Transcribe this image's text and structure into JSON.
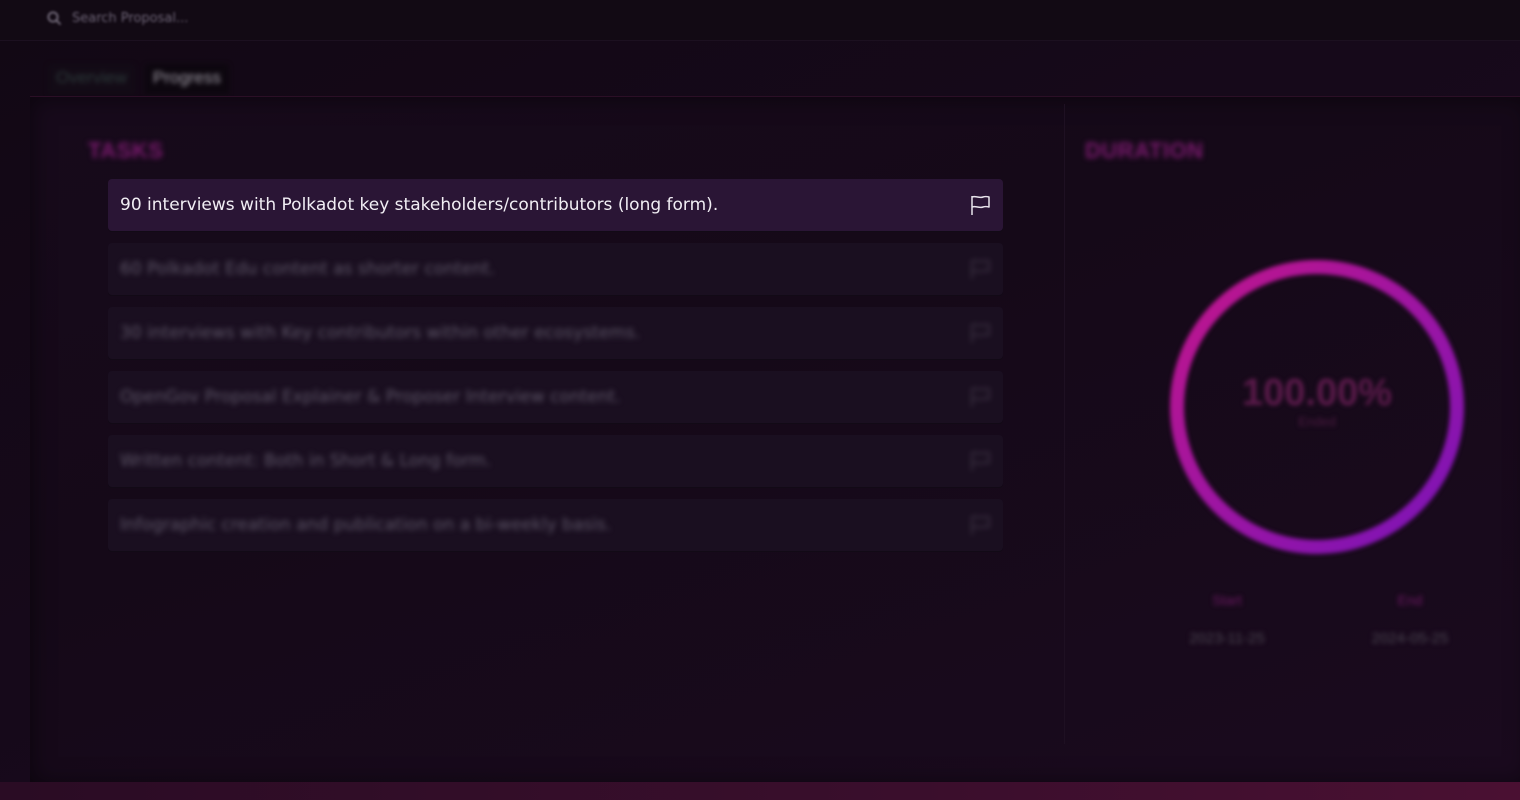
{
  "search": {
    "placeholder": "Search Proposal..."
  },
  "tabs": [
    {
      "label": "Overview",
      "active": false
    },
    {
      "label": "Progress",
      "active": true
    }
  ],
  "tasks": {
    "title": "TASKS",
    "items": [
      {
        "text": "90 interviews with Polkadot key stakeholders/contributors (long form).",
        "highlighted": true
      },
      {
        "text": "60 Polkadot Edu content as shorter content.",
        "highlighted": false
      },
      {
        "text": "30 interviews with Key contributors within other ecosystems.",
        "highlighted": false
      },
      {
        "text": "OpenGov Proposal Explainer & Proposer Interview content.",
        "highlighted": false
      },
      {
        "text": "Written content: Both in Short & Long form.",
        "highlighted": false
      },
      {
        "text": "Infographic creation and publication on a bi-weekly basis.",
        "highlighted": false
      }
    ]
  },
  "duration": {
    "title": "DURATION",
    "percent_text": "100.00%",
    "percent_value": 100,
    "sub_label": "Ended",
    "start_label": "Start",
    "start_date": "2023-11-25",
    "end_label": "End",
    "end_date": "2024-05-25"
  },
  "colors": {
    "accent": "#8a1a7e",
    "ring_start": "#c0168c",
    "ring_end": "#7a14b8",
    "highlight_row": "#2a1535"
  },
  "icons": {
    "search": "search-icon",
    "flag": "flag-icon"
  }
}
